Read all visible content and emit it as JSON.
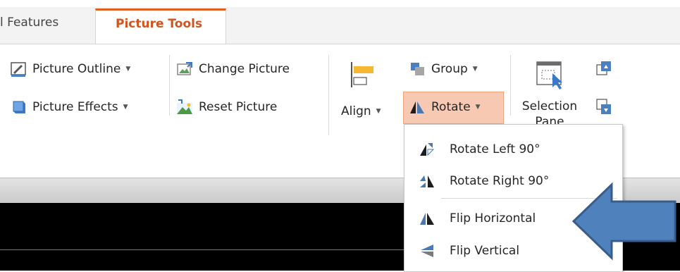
{
  "tabs": {
    "features_label": "l Features",
    "picture_tools_label": "Picture Tools"
  },
  "ribbon": {
    "picture_outline": "Picture Outline",
    "picture_effects": "Picture Effects",
    "change_picture": "Change Picture",
    "reset_picture": "Reset Picture",
    "align": "Align",
    "group": "Group",
    "rotate": "Rotate",
    "selection_pane": "Selection Pane"
  },
  "rotate_menu": {
    "items": [
      {
        "label": "Rotate Left 90°",
        "icon": "rotate-left-icon"
      },
      {
        "label": "Rotate Right 90°",
        "icon": "rotate-right-icon"
      },
      {
        "label": "Flip Horizontal",
        "icon": "flip-horizontal-icon"
      },
      {
        "label": "Flip Vertical",
        "icon": "flip-vertical-icon"
      }
    ]
  },
  "annotation": {
    "arrow_color": "#4f81bd",
    "arrow_outline": "#385d8a"
  },
  "colors": {
    "accent": "#d2531c",
    "highlight": "#f8c9b2"
  }
}
